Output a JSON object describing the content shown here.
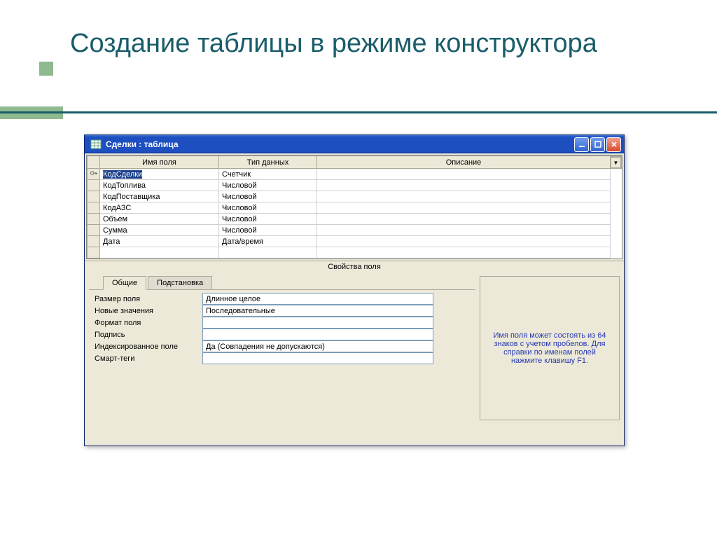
{
  "slide": {
    "title": "Создание таблицы в режиме конструктора"
  },
  "window": {
    "title": "Сделки : таблица",
    "columns": {
      "name": "Имя поля",
      "type": "Тип данных",
      "desc": "Описание"
    },
    "rows": [
      {
        "key": true,
        "name": "КодСделки",
        "type": "Счетчик",
        "desc": ""
      },
      {
        "key": false,
        "name": "КодТоплива",
        "type": "Числовой",
        "desc": ""
      },
      {
        "key": false,
        "name": "КодПоставщика",
        "type": "Числовой",
        "desc": ""
      },
      {
        "key": false,
        "name": "КодАЗС",
        "type": "Числовой",
        "desc": ""
      },
      {
        "key": false,
        "name": "Объем",
        "type": "Числовой",
        "desc": ""
      },
      {
        "key": false,
        "name": "Сумма",
        "type": "Числовой",
        "desc": ""
      },
      {
        "key": false,
        "name": "Дата",
        "type": "Дата/время",
        "desc": ""
      },
      {
        "key": false,
        "name": "",
        "type": "",
        "desc": ""
      }
    ],
    "properties_title": "Свойства поля",
    "tabs": {
      "general": "Общие",
      "lookup": "Подстановка"
    },
    "props": [
      {
        "label": "Размер поля",
        "value": "Длинное целое"
      },
      {
        "label": "Новые значения",
        "value": "Последовательные"
      },
      {
        "label": "Формат поля",
        "value": ""
      },
      {
        "label": "Подпись",
        "value": ""
      },
      {
        "label": "Индексированное поле",
        "value": "Да (Совпадения не допускаются)"
      },
      {
        "label": "Смарт-теги",
        "value": ""
      }
    ],
    "help_text": "Имя поля может состоять из 64 знаков с учетом пробелов.  Для справки по именам полей нажмите клавишу F1."
  }
}
